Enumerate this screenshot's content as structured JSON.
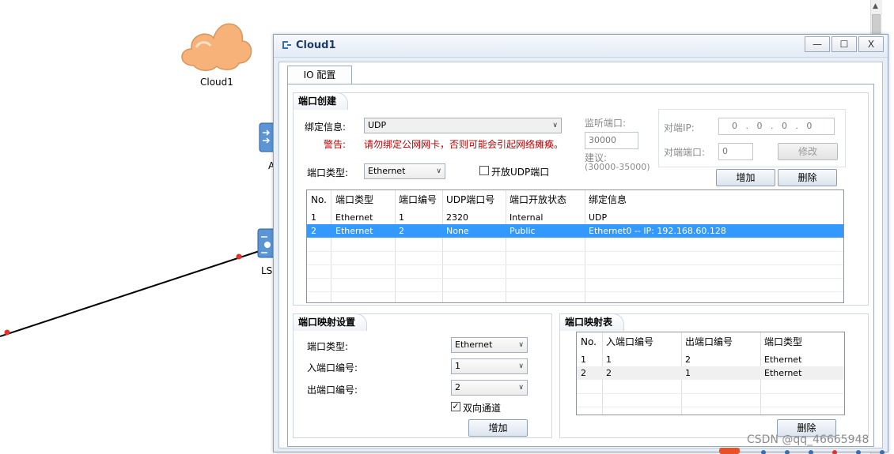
{
  "canvas": {
    "devices": [
      {
        "name": "Cloud1"
      },
      {
        "name": "A"
      },
      {
        "name": "LS"
      }
    ]
  },
  "dialog": {
    "title": "Cloud1",
    "controls": {
      "minimize": "—",
      "maximize": "☐",
      "close": "X"
    },
    "tab": "IO 配置",
    "port_create": {
      "heading": "端口创建",
      "bind_label": "绑定信息:",
      "bind_value": "UDP",
      "warn_label": "警告:",
      "warn_text": "请勿绑定公网网卡，否则可能会引起网络瘫痪。",
      "port_type_label": "端口类型:",
      "port_type_value": "Ethernet",
      "open_udp_label": "开放UDP端口",
      "listen_port_label": "监听端口:",
      "listen_port_value": "30000",
      "suggest_label": "建议:",
      "suggest_range": "(30000-35000)",
      "peer_ip_label": "对端IP:",
      "peer_ip_value": "0   .   0   .   0   .   0",
      "peer_port_label": "对端端口:",
      "peer_port_value": "0",
      "modify_button": "修改",
      "add_button": "增加",
      "delete_button": "删除",
      "table": {
        "columns": [
          "No.",
          "端口类型",
          "端口编号",
          "UDP端口号",
          "端口开放状态",
          "绑定信息"
        ],
        "rows": [
          [
            "1",
            "Ethernet",
            "1",
            "2320",
            "Internal",
            "UDP"
          ],
          [
            "2",
            "Ethernet",
            "2",
            "None",
            "Public",
            "Ethernet0 -- IP: 192.168.60.128"
          ]
        ],
        "selected_row": 2
      }
    },
    "mapping_settings": {
      "heading": "端口映射设置",
      "port_type_label": "端口类型:",
      "port_type_value": "Ethernet",
      "in_port_label": "入端口编号:",
      "in_port_value": "1",
      "out_port_label": "出端口编号:",
      "out_port_value": "2",
      "bidirectional_label": "双向通道",
      "bidirectional_checked": true,
      "add_button": "增加"
    },
    "mapping_table": {
      "heading": "端口映射表",
      "columns": [
        "No.",
        "入端口编号",
        "出端口编号",
        "端口类型"
      ],
      "rows": [
        [
          "1",
          "1",
          "2",
          "Ethernet"
        ],
        [
          "2",
          "2",
          "1",
          "Ethernet"
        ]
      ],
      "delete_button": "删除"
    }
  },
  "watermark": "CSDN @qq_46665948",
  "colors": {
    "selection": "#3399ff",
    "warning": "#c00000",
    "link_line": "#000000",
    "port_dot": "#e03030",
    "cloud": "#f7b27a"
  }
}
